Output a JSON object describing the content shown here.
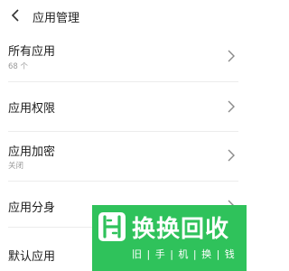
{
  "header": {
    "back_icon": "chevron-left-icon",
    "title": "应用管理"
  },
  "rows": [
    {
      "label": "所有应用",
      "sub": "68 个",
      "icon": "chevron-right-icon"
    },
    {
      "label": "应用权限",
      "sub": "",
      "icon": "chevron-right-icon"
    },
    {
      "label": "应用加密",
      "sub": "关闭",
      "icon": "chevron-right-icon"
    },
    {
      "label": "应用分身",
      "sub": "",
      "icon": "chevron-right-icon"
    },
    {
      "label": "默认应用",
      "sub": "",
      "icon": "chevron-right-icon"
    }
  ],
  "watermark": {
    "title": "换换回收",
    "tagline": "旧 | 手 | 机 | 换 | 钱",
    "brand_color": "#2fc25b"
  }
}
